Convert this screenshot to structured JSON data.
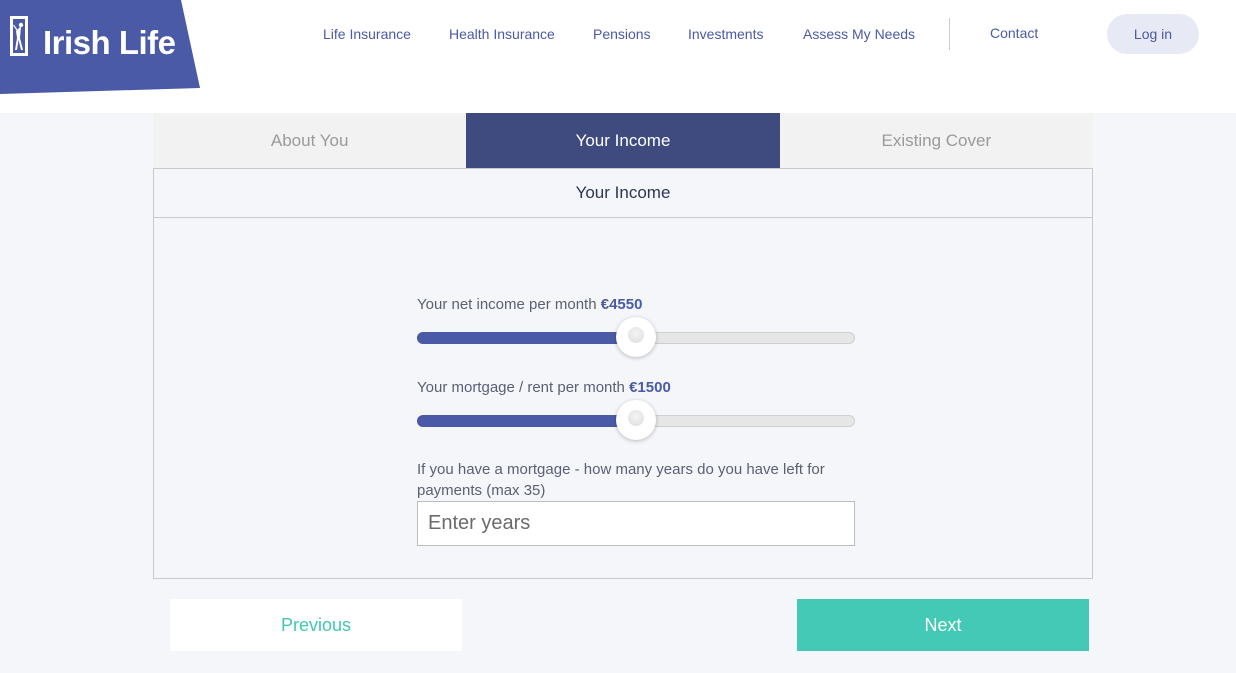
{
  "brand": {
    "name": "Irish Life",
    "color": "#4b5aa6",
    "icon": "irish-life-logo-icon"
  },
  "nav": {
    "items": [
      "Life Insurance",
      "Health Insurance",
      "Pensions",
      "Investments",
      "Assess My Needs"
    ],
    "contact": "Contact",
    "login": "Log in"
  },
  "tabs": [
    {
      "label": "About You",
      "active": false
    },
    {
      "label": "Your Income",
      "active": true
    },
    {
      "label": "Existing Cover",
      "active": false
    }
  ],
  "panel": {
    "title": "Your Income",
    "net_income": {
      "label": "Your net income per month",
      "value": "€4550",
      "fill_fraction": 0.5
    },
    "mortgage": {
      "label": "Your mortgage / rent per month",
      "value": "€1500",
      "fill_fraction": 0.5
    },
    "years": {
      "label": "If you have a mortgage - how many years do you have left for payments (max 35)",
      "placeholder": "Enter years",
      "value": ""
    }
  },
  "buttons": {
    "previous": "Previous",
    "next": "Next"
  },
  "colors": {
    "accent": "#43c9b5",
    "tab_active": "#3f4a7e",
    "primary": "#4b5aa6"
  }
}
